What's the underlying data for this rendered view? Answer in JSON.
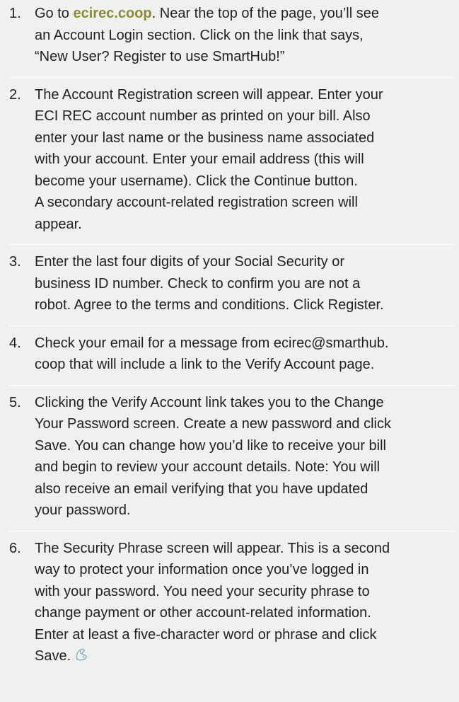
{
  "steps": [
    {
      "number": "1.",
      "intro": "Go to ",
      "link": "ecirec.coop",
      "line1_rest": ". Near the top of the page, you’ll see",
      "lines": [
        "an Account Login section. Click on the link that says,",
        "“New User? Register to use SmartHub!”"
      ]
    },
    {
      "number": "2.",
      "lines": [
        "The Account Registration screen will appear. Enter your",
        "ECI REC account number as printed on your bill. Also",
        "enter your last name or the business name associated",
        "with your account. Enter your email address (this will",
        "become your username). Click the Continue button.",
        "A secondary account-related registration screen will",
        "appear."
      ]
    },
    {
      "number": "3.",
      "lines": [
        "Enter the last four digits of your Social Security or",
        "business ID number. Check to confirm you are not a",
        "robot. Agree to the terms and conditions. Click Register."
      ]
    },
    {
      "number": "4.",
      "lines": [
        "Check your email for a message from ecirec@smarthub.",
        "coop that will include a link to the Verify Account page."
      ]
    },
    {
      "number": "5.",
      "lines": [
        "Clicking the Verify Account link takes you to the Change",
        "Your Password screen. Create a new password and click",
        "Save. You can change how you’d like to receive your bill",
        "and begin to review your account details. Note: You will",
        "also receive an email verifying that you have updated",
        "your password."
      ]
    },
    {
      "number": "6.",
      "lines": [
        "The Security Phrase screen will appear. This is a second",
        "way to protect your information once you’ve logged in",
        "with your password. You need your security phrase to",
        "change payment or other account-related information.",
        "Enter at least a five-character word or phrase and click"
      ],
      "last_line": "Save."
    }
  ],
  "colors": {
    "background": "#f0f0ef",
    "text": "#231f20",
    "link": "#8a8a3a",
    "divider": "#ffffff",
    "end_mark": "#7fb3c9"
  },
  "icons": {
    "end_mark": "end-of-article-icon"
  }
}
